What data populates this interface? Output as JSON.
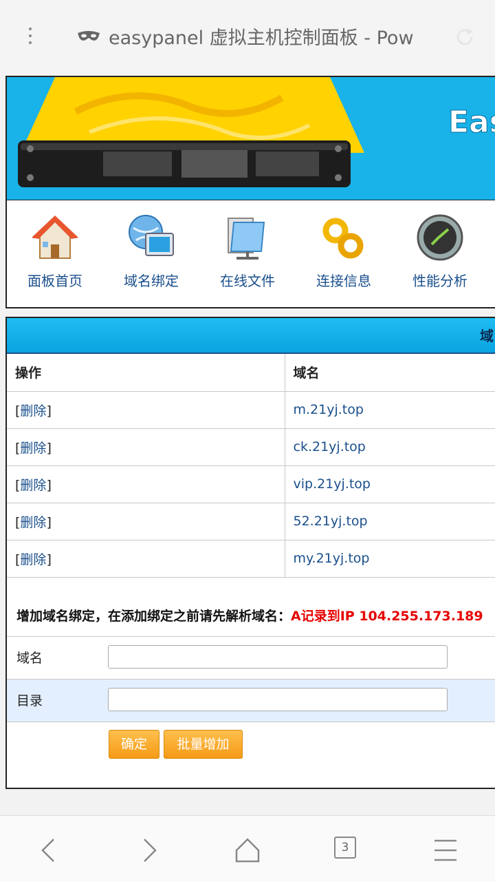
{
  "browser": {
    "title": "easypanel 虚拟主机控制面板 - Pow",
    "tab_count": "3"
  },
  "banner": {
    "logo_text": "Eas"
  },
  "nav": [
    {
      "label": "面板首页"
    },
    {
      "label": "域名绑定"
    },
    {
      "label": "在线文件"
    },
    {
      "label": "连接信息"
    },
    {
      "label": "性能分析"
    }
  ],
  "panel": {
    "header": "域",
    "columns": {
      "action": "操作",
      "domain": "域名"
    },
    "rows": [
      {
        "delete": "删除",
        "domain": "m.21yj.top"
      },
      {
        "delete": "删除",
        "domain": "ck.21yj.top"
      },
      {
        "delete": "删除",
        "domain": "vip.21yj.top"
      },
      {
        "delete": "删除",
        "domain": "52.21yj.top"
      },
      {
        "delete": "删除",
        "domain": "my.21yj.top"
      }
    ],
    "add_note": "增加域名绑定，在添加绑定之前请先解析域名：",
    "add_note_red": "A记录到IP 104.255.173.189",
    "form": {
      "domain_label": "域名",
      "domain_value": "",
      "dir_label": "目录",
      "dir_value": "",
      "confirm_button": "确定",
      "batch_button": "批量增加"
    }
  },
  "colors": {
    "banner_blue": "#19b2e9",
    "link_blue": "#1a4f8c",
    "note_red": "#e60000",
    "button_orange": "#f59a17"
  }
}
